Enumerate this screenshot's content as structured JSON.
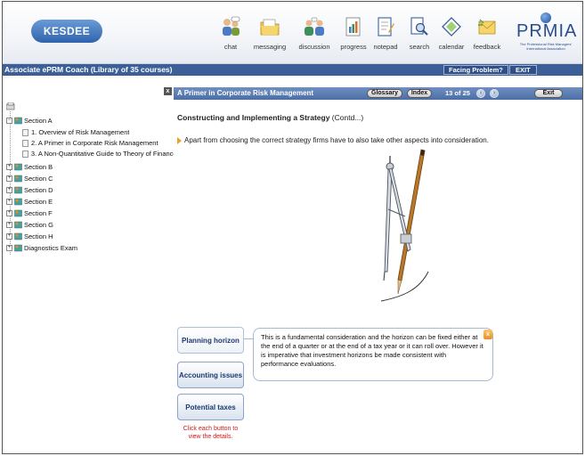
{
  "header": {
    "kesdee_logo": "KESDEE",
    "toolbar": [
      {
        "label": "chat",
        "icon": "chat-icon"
      },
      {
        "label": "messaging",
        "icon": "messaging-icon"
      },
      {
        "label": "discussion",
        "icon": "discussion-icon"
      },
      {
        "label": "progress",
        "icon": "progress-icon"
      },
      {
        "label": "notepad",
        "icon": "notepad-icon"
      },
      {
        "label": "search",
        "icon": "search-icon"
      },
      {
        "label": "calendar",
        "icon": "calendar-icon"
      },
      {
        "label": "feedback",
        "icon": "feedback-icon"
      }
    ],
    "prmia_logo": "PRMIA",
    "prmia_tagline_1": "The Professional Risk Managers'",
    "prmia_tagline_2": "International Association"
  },
  "topbar": {
    "course_title": "Associate ePRM Coach (Library of 35 courses)",
    "facing_problem": "Facing Problem?",
    "exit": "EXIT"
  },
  "sidebar": {
    "close_glyph": "x",
    "section_a": "Section A",
    "section_a_items": [
      "1. Overview of Risk Management",
      "2. A Primer in Corporate Risk Management",
      "3. A Non-Quantitative Guide to Theory of Finance"
    ],
    "sections": [
      "Section B",
      "Section C",
      "Section D",
      "Section E",
      "Section F",
      "Section G",
      "Section H",
      "Diagnostics Exam"
    ]
  },
  "content_bar": {
    "title": "A Primer in Corporate Risk Management",
    "glossary": "Glossary",
    "index": "Index",
    "page": "13 of 25",
    "exit": "Exit"
  },
  "content": {
    "heading_bold": "Constructing and Implementing a Strategy",
    "heading_suffix": " (Contd...)",
    "intro": "Apart from choosing the correct strategy firms have to also take other aspects into consideration.",
    "tabs": [
      "Planning horizon",
      "Accounting issues",
      "Potential taxes"
    ],
    "hint": "Click each button to view the details.",
    "detail": "This is a fundamental consideration and the horizon can be fixed either at the end of a quarter or at the end of a tax year or it can roll over. However it is imperative that investment horizons be made consistent with performance evaluations.",
    "detail_close": "x"
  },
  "colors": {
    "bar_blue": "#3d5f97",
    "accent_orange": "#f08d1a",
    "hint_red": "#d01818"
  }
}
